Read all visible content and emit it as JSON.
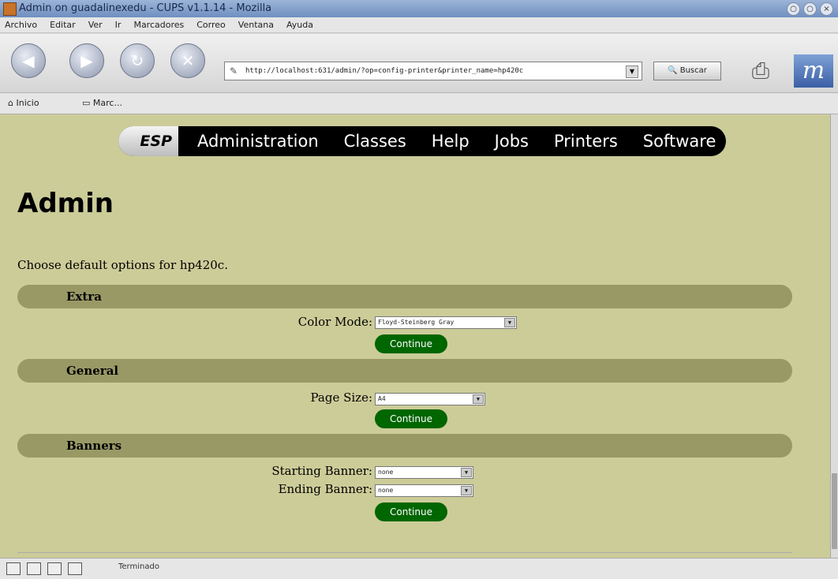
{
  "window": {
    "title": "Admin on guadalinexedu - CUPS v1.1.14 - Mozilla",
    "controls": [
      "○",
      "○",
      "×"
    ]
  },
  "menu": [
    "Archivo",
    "Editar",
    "Ver",
    "Ir",
    "Marcadores",
    "Correo",
    "Ventana",
    "Ayuda"
  ],
  "toolbar": {
    "url": "http://localhost:631/admin/?op=config-printer&printer_name=hp420c",
    "search_label": "Buscar",
    "back_icon": "◀",
    "forward_icon": "▶",
    "reload_icon": "↻",
    "stop_icon": "✕",
    "lock_icon": "✎",
    "print_icon": "⎙",
    "logo_text": "m"
  },
  "bookmarks": [
    {
      "label": "Inicio"
    },
    {
      "label": "Marc..."
    }
  ],
  "nav": {
    "brand": "ESP",
    "links": [
      "Administration",
      "Classes",
      "Help",
      "Jobs",
      "Printers",
      "Software"
    ]
  },
  "page": {
    "title": "Admin",
    "intro": "Choose default options for hp420c.",
    "continue_label": "Continue"
  },
  "sections": {
    "extra": {
      "heading": "Extra",
      "color_mode_label": "Color Mode:",
      "color_mode_value": "Floyd-Steinberg Gray"
    },
    "general": {
      "heading": "General",
      "page_size_label": "Page Size:",
      "page_size_value": "A4"
    },
    "banners": {
      "heading": "Banners",
      "starting_label": "Starting Banner:",
      "starting_value": "none",
      "ending_label": "Ending Banner:",
      "ending_value": "none"
    }
  },
  "status": {
    "text": "Terminado"
  }
}
